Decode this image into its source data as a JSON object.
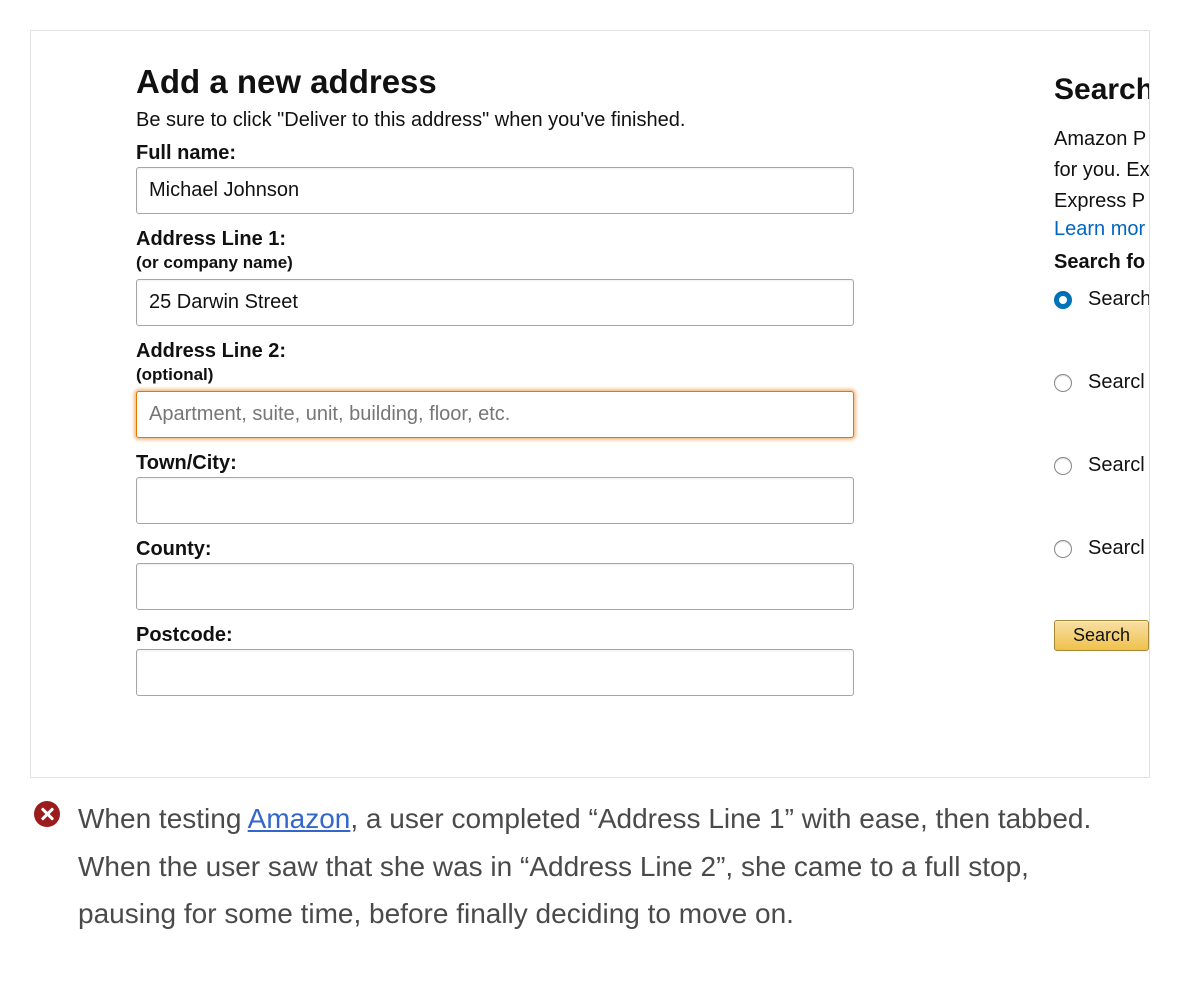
{
  "form": {
    "title": "Add a new address",
    "subtitle": "Be sure to click \"Deliver to this address\" when you've finished.",
    "full_name_label": "Full name:",
    "full_name_value": "Michael Johnson",
    "addr1_label": "Address Line 1:",
    "addr1_hint": "(or company name)",
    "addr1_value": "25 Darwin Street",
    "addr2_label": "Address Line 2:",
    "addr2_hint": "(optional)",
    "addr2_value": "",
    "addr2_placeholder": "Apartment, suite, unit, building, floor, etc.",
    "town_label": "Town/City:",
    "town_value": "",
    "county_label": "County:",
    "county_value": "",
    "postcode_label": "Postcode:",
    "postcode_value": ""
  },
  "sidebar": {
    "title": "Search",
    "text1": "Amazon P",
    "text2": "for you. Ex",
    "text3": "Express P",
    "link": "Learn mor",
    "subtitle": "Search fo",
    "radios": [
      {
        "label": "Search",
        "checked": true
      },
      {
        "label": "Searcl",
        "checked": false
      },
      {
        "label": "Searcl",
        "checked": false
      },
      {
        "label": "Searcl",
        "checked": false
      }
    ],
    "button": "Search"
  },
  "caption": {
    "pre": "When testing ",
    "link": "Amazon",
    "post": ", a user completed “Address Line 1” with ease, then tabbed. When the user saw that she was in “Address Line 2”, she came to a full stop, pausing for some time, before finally deciding to move on."
  }
}
